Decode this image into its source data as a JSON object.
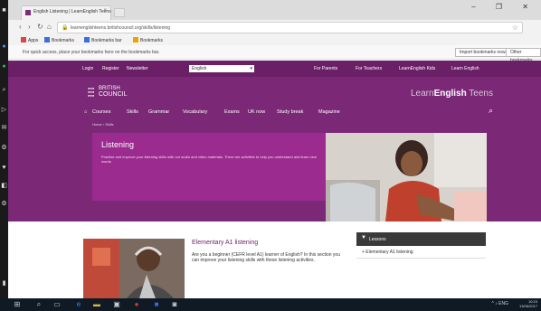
{
  "browser": {
    "tab_title": "English Listening | LearnEnglish Teens",
    "close_tab": "×",
    "window_controls": "–  ❐  ✕",
    "url": "learnenglishteens.britishcouncil.org/skills/listening",
    "bookmarks": [
      "Apps",
      "Bookmarks",
      "Bookmarks bar",
      "Bookmarks"
    ],
    "infobar_message": "For quick access, place your bookmarks here on the bookmarks bar.",
    "infobar_buttons": [
      "Import bookmarks now...",
      "Other bookmarks"
    ]
  },
  "site": {
    "top_links": [
      "Login",
      "Register",
      "Newsletter"
    ],
    "language": "English",
    "top_right_links": [
      "For Parents",
      "For Teachers",
      "LearnEnglish Kids",
      "Learn English"
    ],
    "logo": {
      "line1": "BRITISH",
      "line2": "COUNCIL"
    },
    "brand": {
      "prefix": "Learn",
      "bold": "English",
      "suffix": " Teens"
    },
    "nav": [
      "Courses",
      "Skills",
      "Grammar",
      "Vocabulary",
      "Exams",
      "UK now",
      "Study break",
      "Magazine"
    ],
    "breadcrumb": "Home › Skills",
    "listening": {
      "title": "Listening",
      "description": "Practise and improve your listening skills with our audio and video materials. There are activities to help you understand and learn new words."
    },
    "featured": {
      "title": "Elementary A1 listening",
      "description": "Are you a beginner (CEFR level A1) learner of English? In this section you can improve your listening skills with these listening activities."
    },
    "lessons": {
      "header": "Lessons",
      "item": "+ Elementary A1 listening"
    }
  },
  "taskbar": {
    "time": "10:23",
    "date": "13/06/2017",
    "tray": "^ ♪ ENG"
  }
}
